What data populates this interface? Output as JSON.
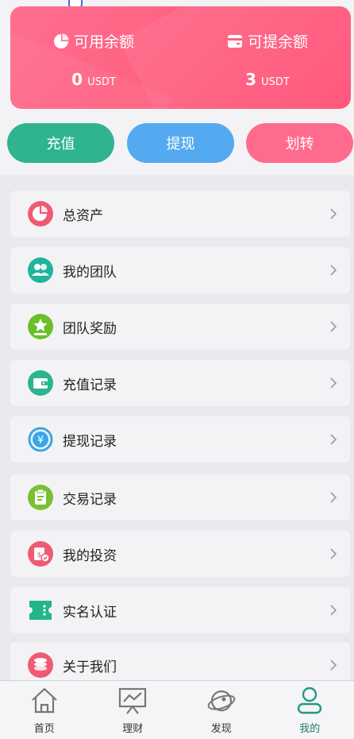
{
  "balances": {
    "available": {
      "label": "可用余额",
      "amount": "0",
      "unit": "USDT",
      "icon": "pie-chart-icon"
    },
    "withdrawable": {
      "label": "可提余额",
      "amount": "3",
      "unit": "USDT",
      "icon": "card-icon"
    }
  },
  "actions": {
    "recharge": "充值",
    "withdraw": "提现",
    "transfer": "划转"
  },
  "menu": [
    {
      "label": "总资产",
      "icon": "pie-chart-icon",
      "color": "#ef5a72"
    },
    {
      "label": "我的团队",
      "icon": "team-icon",
      "color": "#1fb59a"
    },
    {
      "label": "团队奖励",
      "icon": "award-star-icon",
      "color": "#6bbf2a"
    },
    {
      "label": "充值记录",
      "icon": "wallet-icon",
      "color": "#2ab48f"
    },
    {
      "label": "提现记录",
      "icon": "yen-refresh-icon",
      "color": "#37a7e6"
    },
    {
      "label": "交易记录",
      "icon": "clipboard-icon",
      "color": "#79c032"
    },
    {
      "label": "我的投资",
      "icon": "investment-icon",
      "color": "#ef5a72"
    },
    {
      "label": "实名认证",
      "icon": "id-ticket-icon",
      "color": "#23b48a"
    },
    {
      "label": "关于我们",
      "icon": "coins-icon",
      "color": "#ef5a72"
    }
  ],
  "nav": [
    {
      "label": "首页",
      "icon": "home-icon"
    },
    {
      "label": "理财",
      "icon": "chart-board-icon"
    },
    {
      "label": "发现",
      "icon": "planet-icon"
    },
    {
      "label": "我的",
      "icon": "user-icon",
      "active": true
    }
  ],
  "colors": {
    "card": "#ff5f80",
    "recharge": "#2fb48f",
    "withdraw": "#54aaf0",
    "transfer": "#ff6b8c",
    "nav_active": "#1f7a6e"
  }
}
